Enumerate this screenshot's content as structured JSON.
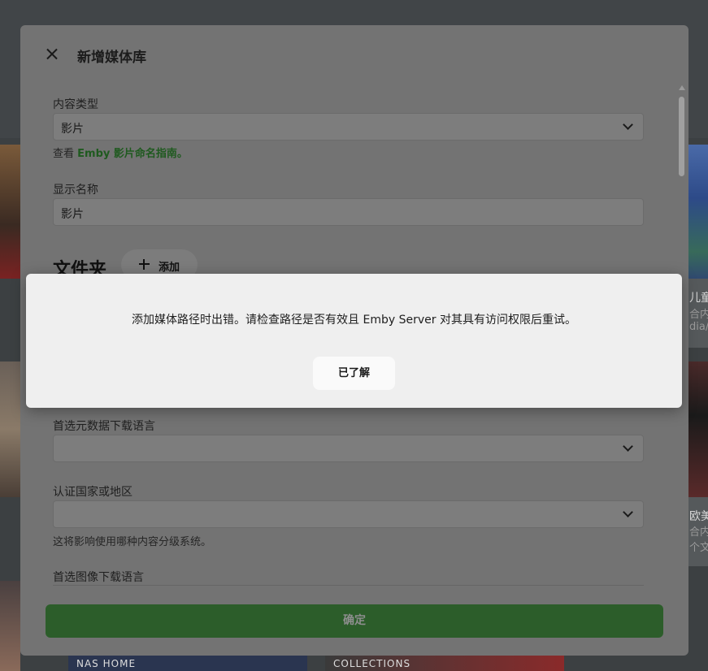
{
  "background": {
    "right_cards": [
      {
        "title": "儿童",
        "subtitle": "合内",
        "extra": "dia/"
      },
      {
        "title": "欧美",
        "subtitle": "合内",
        "extra": "个文"
      }
    ],
    "thumb_labels": [
      "NAS HOME",
      "COLLECTIONS"
    ]
  },
  "dialog": {
    "title": "新增媒体库",
    "content_type": {
      "label": "内容类型",
      "value": "影片"
    },
    "guide": {
      "prefix": "查看 ",
      "link": "Emby 影片命名指南。"
    },
    "display_name": {
      "label": "显示名称",
      "value": "影片"
    },
    "folders": {
      "title": "文件夹",
      "add_label": "添加"
    },
    "metadata_language": {
      "label": "首选元数据下载语言",
      "value": ""
    },
    "certification_country": {
      "label": "认证国家或地区",
      "value": "",
      "helper": "这将影响使用哪种内容分级系统。"
    },
    "image_language": {
      "label": "首选图像下载语言"
    },
    "confirm_label": "确定"
  },
  "alert": {
    "message": "添加媒体路径时出错。请检查路径是否有效且 Emby Server 对其具有访问权限后重试。",
    "button_label": "已了解"
  },
  "colors": {
    "confirm_button": "#2c5d2a",
    "link": "#1f5a1f",
    "dialog_bg": "#737373",
    "alert_bg": "#efefef"
  }
}
